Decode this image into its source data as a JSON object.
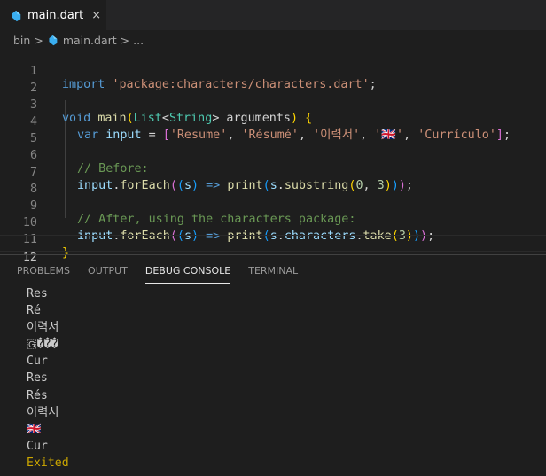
{
  "tab": {
    "filename": "main.dart",
    "close": "×",
    "icon": "dart-file-icon"
  },
  "breadcrumb": {
    "folder": "bin",
    "sep1": ">",
    "file": "main.dart",
    "sep2": ">",
    "more": "..."
  },
  "editor": {
    "line_numbers": [
      "1",
      "2",
      "3",
      "4",
      "5",
      "6",
      "7",
      "8",
      "9",
      "10",
      "11",
      "12"
    ],
    "lines": {
      "l1": {
        "kw": "import",
        "sp": " ",
        "str": "'package:characters/characters.dart'",
        "semi": ";"
      },
      "l3": {
        "kw": "void",
        "fn": "main",
        "open": "(",
        "type1": "List",
        "lt": "<",
        "type2": "String",
        "gt": ">",
        "param": " arguments",
        "close": ")",
        "brace": " {"
      },
      "l4": {
        "kw": "var",
        "var": " input",
        "eq": " = ",
        "lb": "[",
        "s1": "'Resume'",
        "c1": ", ",
        "s2": "'Résumé'",
        "c2": ", ",
        "s3": "'이력서'",
        "c3": ", ",
        "s4": "'🇬🇧'",
        "c4": ", ",
        "s5": "'Currículo'",
        "rb": "]",
        "semi": ";"
      },
      "l6": {
        "cmt": "// Before:"
      },
      "l7": {
        "var": "input",
        "dot": ".",
        "fn": "forEach",
        "p1": "(",
        "p2": "(",
        "s": "s",
        "p3": ")",
        "arrow": " => ",
        "fn2": "print",
        "p4": "(",
        "obj": "s",
        "dot2": ".",
        "fn3": "substring",
        "p5": "(",
        "n1": "0",
        "comma": ", ",
        "n2": "3",
        "p6": ")",
        "p7": ")",
        "p8": ")",
        "semi": ";"
      },
      "l9": {
        "cmt": "// After, using the characters package:"
      },
      "l10": {
        "var": "input",
        "dot": ".",
        "fn": "forEach",
        "p1": "(",
        "p2": "(",
        "s": "s",
        "p3": ")",
        "arrow": " => ",
        "fn2": "print",
        "p4": "(",
        "obj": "s",
        "dot2": ".",
        "prop": "characters",
        "dot3": ".",
        "fn3": "take",
        "p5": "(",
        "n1": "3",
        "p6": ")",
        "p7": ")",
        "p8": ")",
        "semi": ";"
      },
      "l11": {
        "brace": "}"
      }
    }
  },
  "panel": {
    "tabs": [
      "PROBLEMS",
      "OUTPUT",
      "DEBUG CONSOLE",
      "TERMINAL"
    ],
    "active_tab": "DEBUG CONSOLE",
    "console_lines": [
      "Res",
      "Ré",
      "이력서",
      "🇬���",
      "Cur",
      "Res",
      "Rés",
      "이력서",
      "🇬🇧",
      "Cur"
    ],
    "exited": "Exited"
  },
  "colors": {
    "background": "#1e1e1e",
    "keyword": "#569cd6",
    "string": "#ce9178",
    "comment": "#6a9955",
    "exited": "#cca700"
  }
}
